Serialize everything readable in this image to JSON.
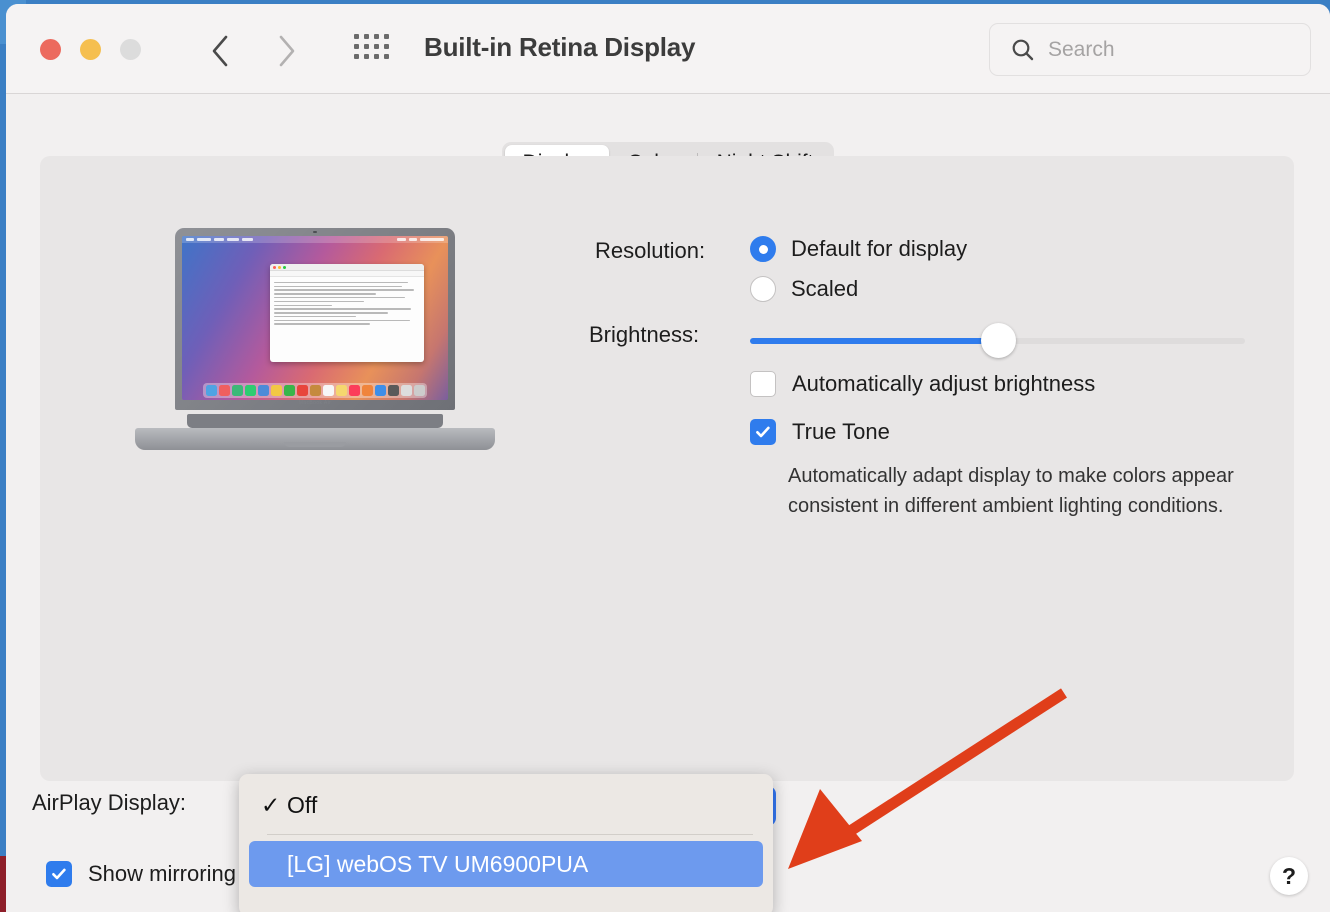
{
  "window": {
    "title": "Built-in Retina Display",
    "traffic_lights": [
      "close-red",
      "minimize-yellow",
      "zoom-gray"
    ],
    "nav": {
      "back": "back-chevron",
      "forward": "forward-chevron"
    },
    "grid_button": "show-all-grid-icon"
  },
  "search": {
    "placeholder": "Search",
    "value": "",
    "icon": "search-icon"
  },
  "tabs": [
    {
      "label": "Display",
      "active": true
    },
    {
      "label": "Color",
      "active": false
    },
    {
      "label": "Night Shift",
      "active": false
    }
  ],
  "preview": {
    "device_label": "MacBook Air",
    "document_title": "Think Different"
  },
  "settings": {
    "resolution_label": "Resolution:",
    "resolution_options": [
      {
        "label": "Default for display",
        "selected": true
      },
      {
        "label": "Scaled",
        "selected": false
      }
    ],
    "brightness_label": "Brightness:",
    "brightness_percent": 50,
    "auto_brightness": {
      "label": "Automatically adjust brightness",
      "checked": false
    },
    "true_tone": {
      "label": "True Tone",
      "checked": true
    },
    "true_tone_description": "Automatically adapt display to make colors appear consistent in different ambient lighting conditions."
  },
  "bottom": {
    "airplay_label": "AirPlay Display:",
    "airplay_value": "Off",
    "show_mirroring": {
      "label": "Show mirroring options in the menu bar when available",
      "checked": true
    },
    "help_label": "?"
  },
  "dropdown": {
    "open": true,
    "items": [
      {
        "label": "Off",
        "checked": true,
        "highlighted": false
      },
      {
        "label": "[LG] webOS TV UM6900PUA",
        "checked": false,
        "highlighted": true
      }
    ]
  },
  "annotation": {
    "type": "arrow",
    "color": "#e03e1a",
    "points_to": "dropdown-item-lg-tv"
  },
  "colors": {
    "accent_blue": "#2f7ced",
    "window_bg": "#f2f0f0",
    "panel_bg": "#e8e6e6",
    "popup_bg": "#ece8e4",
    "popup_highlight": "#6d9aee",
    "annotation_red": "#e03e1a",
    "title_text": "#3c3c3c"
  }
}
